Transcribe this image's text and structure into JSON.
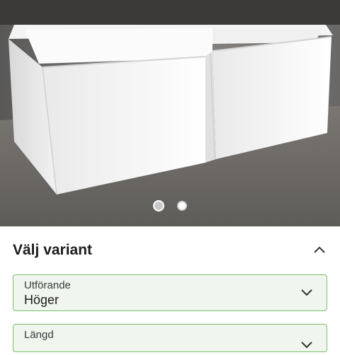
{
  "gallery": {
    "image_alt": "L-shaped white bathtub with front panel",
    "slides": 2,
    "active_index": 0
  },
  "variant": {
    "title": "Välj variant",
    "collapse_icon": "chevron-up-icon",
    "fields": [
      {
        "label": "Utförande",
        "value": "Höger",
        "icon": "chevron-down-icon"
      },
      {
        "label": "Längd",
        "value": "",
        "icon": "chevron-down-icon"
      }
    ]
  },
  "colors": {
    "field_border": "#7bbf6a",
    "field_background": "#f0f5ee"
  }
}
